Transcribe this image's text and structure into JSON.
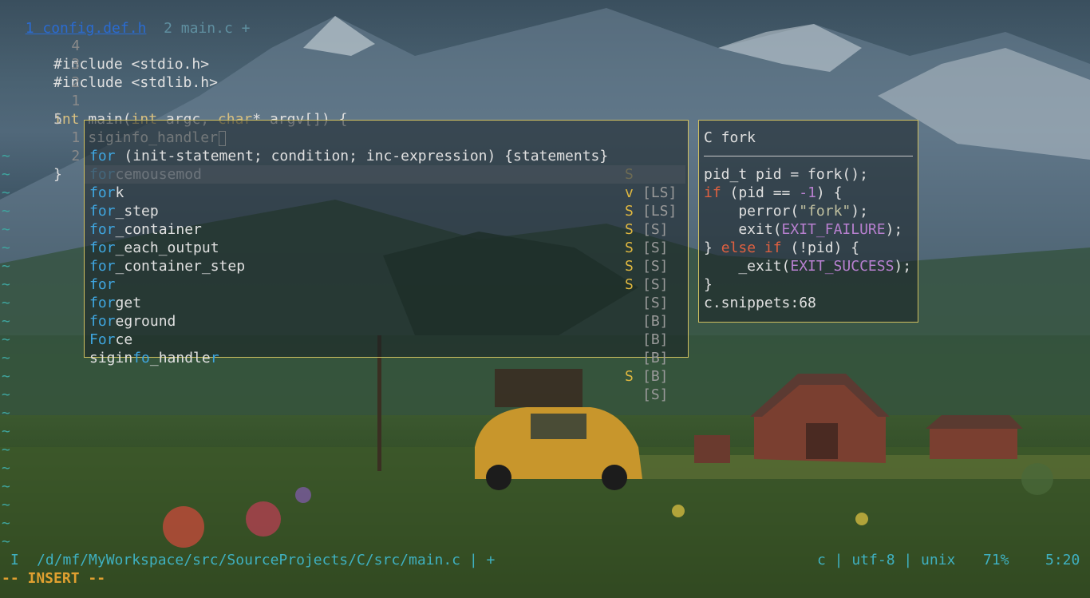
{
  "tabs": [
    {
      "label": "1 config.def.h"
    },
    {
      "label": "2 main.c +"
    }
  ],
  "editor": {
    "lines": [
      {
        "num": "4",
        "text": "#include <stdio.h>"
      },
      {
        "num": "3",
        "text": "#include <stdlib.h>"
      },
      {
        "num": "2",
        "text": ""
      },
      {
        "num": "1",
        "pre": "",
        "t1": "int",
        "mid": " main(",
        "t2": "int",
        "mid2": " argc, ",
        "t3": "char",
        "end": "* argv[]) {"
      },
      {
        "num": "5",
        "text": "    siginfo_handler"
      },
      {
        "num": "1",
        "text": ""
      },
      {
        "num": "2",
        "text": "}"
      }
    ],
    "tilde": "~"
  },
  "completion": {
    "items": [
      {
        "match": "for",
        "rest": " (init-statement; condition; inc-expression) {statements}",
        "kind": "S",
        "source": "[LS]"
      },
      {
        "match": "for",
        "rest": "cemousemod",
        "kind": "v",
        "source": "[LS]"
      },
      {
        "match": "for",
        "rest": "k",
        "kind": "S",
        "source": "[S]",
        "selected": true
      },
      {
        "match": "for",
        "rest": "_step",
        "kind": "S",
        "source": "[S]"
      },
      {
        "match": "for",
        "rest": "_container",
        "kind": "S",
        "source": "[S]"
      },
      {
        "match": "for",
        "rest": "_each_output",
        "kind": "S",
        "source": "[S]"
      },
      {
        "match": "for",
        "rest": "_container_step",
        "kind": "S",
        "source": "[S]"
      },
      {
        "match": "for",
        "rest": "",
        "kind": "",
        "source": "[B]"
      },
      {
        "match": "for",
        "rest": "get",
        "kind": "",
        "source": "[B]"
      },
      {
        "match": "for",
        "rest": "eground",
        "kind": "",
        "source": "[B]"
      },
      {
        "match": "For",
        "rest": "ce",
        "kind": "",
        "source": "[B]"
      },
      {
        "pre": "sigin",
        "match": "fo",
        "mid": "_handle",
        "match2": "r",
        "kind": "S",
        "source": "[S]"
      }
    ]
  },
  "preview": {
    "title": "C fork",
    "code": [
      "pid_t pid = fork();",
      "if (pid == -1) {",
      "    perror(\"fork\");",
      "    exit(EXIT_FAILURE);",
      "} else if (!pid) {",
      "    _exit(EXIT_SUCCESS);",
      "}"
    ],
    "source": "c.snippets:68"
  },
  "statusline": {
    "mode_indicator": "I",
    "path": "/d/mf/MyWorkspace/src/SourceProjects/C/src/main.c | +",
    "filetype": "c | utf-8 | unix",
    "percent": "71%",
    "position": "5:20"
  },
  "modeline": "-- INSERT --",
  "colors": {
    "accent_border": "#d0c060",
    "match": "#3fa6e0",
    "kind": "#e0b840",
    "tilde": "#3fa6a0",
    "status": "#3fb0c0",
    "mode": "#e0a030"
  }
}
